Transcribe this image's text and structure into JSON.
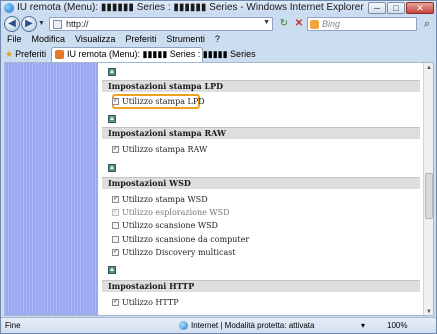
{
  "window": {
    "title": "IU remota (Menu): ▮▮▮▮▮▮ Series : ▮▮▮▮▮▮ Series - Windows Internet Explorer",
    "minimize": "─",
    "maximize": "□",
    "close": "✕"
  },
  "nav": {
    "back": "◀",
    "forward": "▶",
    "address_value": "http://",
    "refresh": "↻",
    "stop": "✕",
    "search_placeholder": "Bing",
    "search_icon": "⌕"
  },
  "menu": {
    "items": [
      "File",
      "Modifica",
      "Visualizza",
      "Preferiti",
      "Strumenti",
      "?"
    ]
  },
  "tabs": {
    "favorites_label": "Preferiti",
    "active_tab": "IU remota (Menu): ▮▮▮▮▮ Series : ▮▮▮▮▮ Series"
  },
  "icons": {
    "collapse": "collapse-arrow-icon",
    "checkbox": "checkbox-icon",
    "globe": "internet-zone-icon"
  },
  "colors": {
    "highlight_border": "#f0a21c",
    "sidebar_bg": "#9aa6f0",
    "section_bg": "#dedede"
  },
  "sections": [
    {
      "title": "Impostazioni stampa LPD",
      "options": [
        {
          "label": "Utilizzo stampa LPD",
          "checked": true,
          "enabled": true,
          "highlighted": true
        }
      ]
    },
    {
      "title": "Impostazioni stampa RAW",
      "options": [
        {
          "label": "Utilizzo stampa RAW",
          "checked": true,
          "enabled": true
        }
      ]
    },
    {
      "title": "Impostazioni WSD",
      "options": [
        {
          "label": "Utilizzo stampa WSD",
          "checked": true,
          "enabled": true
        },
        {
          "label": "Utilizzo esplorazione WSD",
          "checked": true,
          "enabled": false
        },
        {
          "label": "Utilizzo scansione WSD",
          "checked": false,
          "enabled": true
        },
        {
          "label": "Utilizzo scansione da computer",
          "checked": false,
          "enabled": true
        },
        {
          "label": "Utilizzo Discovery multicast",
          "checked": true,
          "enabled": true
        }
      ]
    },
    {
      "title": "Impostazioni HTTP",
      "options": [
        {
          "label": "Utilizzo HTTP",
          "checked": true,
          "enabled": true
        }
      ]
    }
  ],
  "status": {
    "left_text": "Fine",
    "zone_text": "Internet | Modalità protetta: attivata",
    "tools": "▾",
    "zoom": "100%"
  }
}
